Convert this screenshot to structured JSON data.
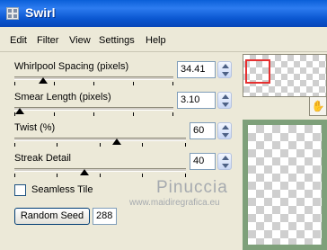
{
  "window": {
    "title": "Swirl"
  },
  "menu": [
    "Edit",
    "Filter",
    "View",
    "Settings",
    "Help"
  ],
  "controls": {
    "whirlpool_spacing": {
      "label": "Whirlpool Spacing (pixels)",
      "value": "34.41",
      "level": 0.15
    },
    "smear_length": {
      "label": "Smear Length (pixels)",
      "value": "3.10",
      "level": 0.03
    },
    "twist": {
      "label": "Twist (%)",
      "value": "60",
      "level": 0.6
    },
    "streak_detail": {
      "label": "Streak Detail",
      "value": "40",
      "level": 0.4
    }
  },
  "seamless_tile": {
    "label": "Seamless Tile",
    "checked": false
  },
  "random_seed": {
    "button_label": "Random Seed",
    "value": "288"
  },
  "watermark": {
    "line1": "Pinuccia",
    "line2": "www.maidiregrafica.eu"
  },
  "icons": [
    "app-icon",
    "spin-up-icon",
    "spin-down-icon",
    "hand-pan-icon"
  ]
}
